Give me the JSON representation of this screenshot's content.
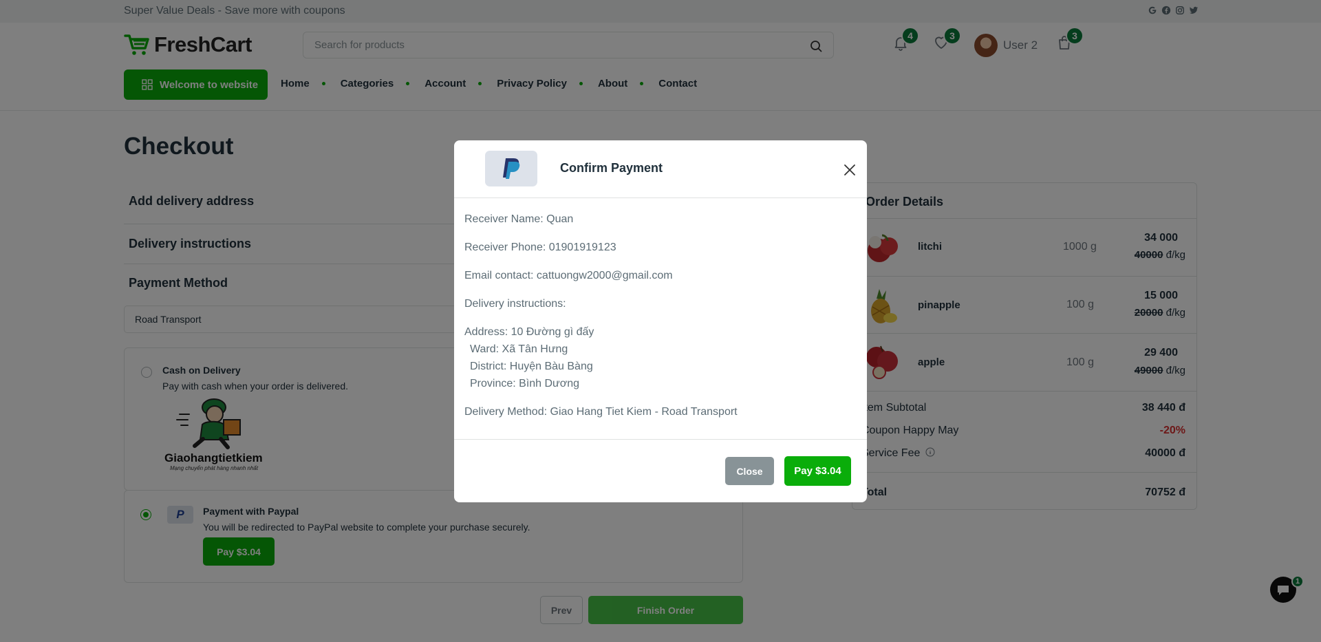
{
  "topbar": {
    "promo": "Super Value Deals - Save more with coupons",
    "socials": [
      "google-icon",
      "facebook-icon",
      "instagram-icon",
      "twitter-icon"
    ]
  },
  "header": {
    "logo_text": "FreshCart",
    "search_placeholder": "Search for products",
    "notifications_count": "4",
    "wishlist_count": "3",
    "user_name": "User 2",
    "cart_count": "3"
  },
  "nav": {
    "welcome_label": "Welcome to website",
    "items": [
      "Home",
      "Categories",
      "Account",
      "Privacy Policy",
      "About",
      "Contact"
    ]
  },
  "checkout": {
    "title": "Checkout",
    "sections": [
      "Add delivery address",
      "Delivery instructions",
      "Payment Method"
    ],
    "transport_selected": "Road Transport",
    "cod": {
      "title": "Cash on Delivery",
      "desc": "Pay with cash when your order is delivered.",
      "brand": "Giaohangtietkiem",
      "tagline": "Mạng chuyển phát hàng nhanh nhất"
    },
    "paypal": {
      "title": "Payment with Paypal",
      "desc": "You will be redirected to PayPal website to complete your purchase securely.",
      "pay_label": "Pay $3.04"
    },
    "prev_label": "Prev",
    "finish_label": "Finish Order"
  },
  "order": {
    "title": "Order Details",
    "items": [
      {
        "name": "litchi",
        "weight": "1000 g",
        "price": "34 000",
        "old_price": "40000",
        "unit": "đ/kg"
      },
      {
        "name": "pinapple",
        "weight": "100 g",
        "price": "15 000",
        "old_price": "20000",
        "unit": "đ/kg"
      },
      {
        "name": "apple",
        "weight": "100 g",
        "price": "29 400",
        "old_price": "49000",
        "unit": "đ/kg"
      }
    ],
    "subtotal_label": "Item Subtotal",
    "subtotal": "38 440 đ",
    "coupon_label": "Coupon Happy May",
    "coupon": "-20%",
    "fee_label": "Service Fee",
    "fee": "40000 đ",
    "total_label": "Total",
    "total": "70752 đ"
  },
  "chat": {
    "badge": "1"
  },
  "modal": {
    "title": "Confirm Payment",
    "receiver_name": "Receiver Name: Quan",
    "receiver_phone": "Receiver Phone: 01901919123",
    "email": "Email contact: cattuongw2000@gmail.com",
    "instructions": "Delivery instructions:",
    "address": "Address: 10 Đường gì đấy",
    "ward": "Ward: Xã Tân Hưng",
    "district": "District: Huyện Bàu Bàng",
    "province": "Province: Bình Dương",
    "method": "Delivery Method: Giao Hang Tiet Kiem - Road Transport",
    "close_label": "Close",
    "pay_label": "Pay $3.04"
  },
  "colors": {
    "accent": "#0aad0a",
    "badge": "#0a7a3a",
    "coupon": "#db3030"
  }
}
